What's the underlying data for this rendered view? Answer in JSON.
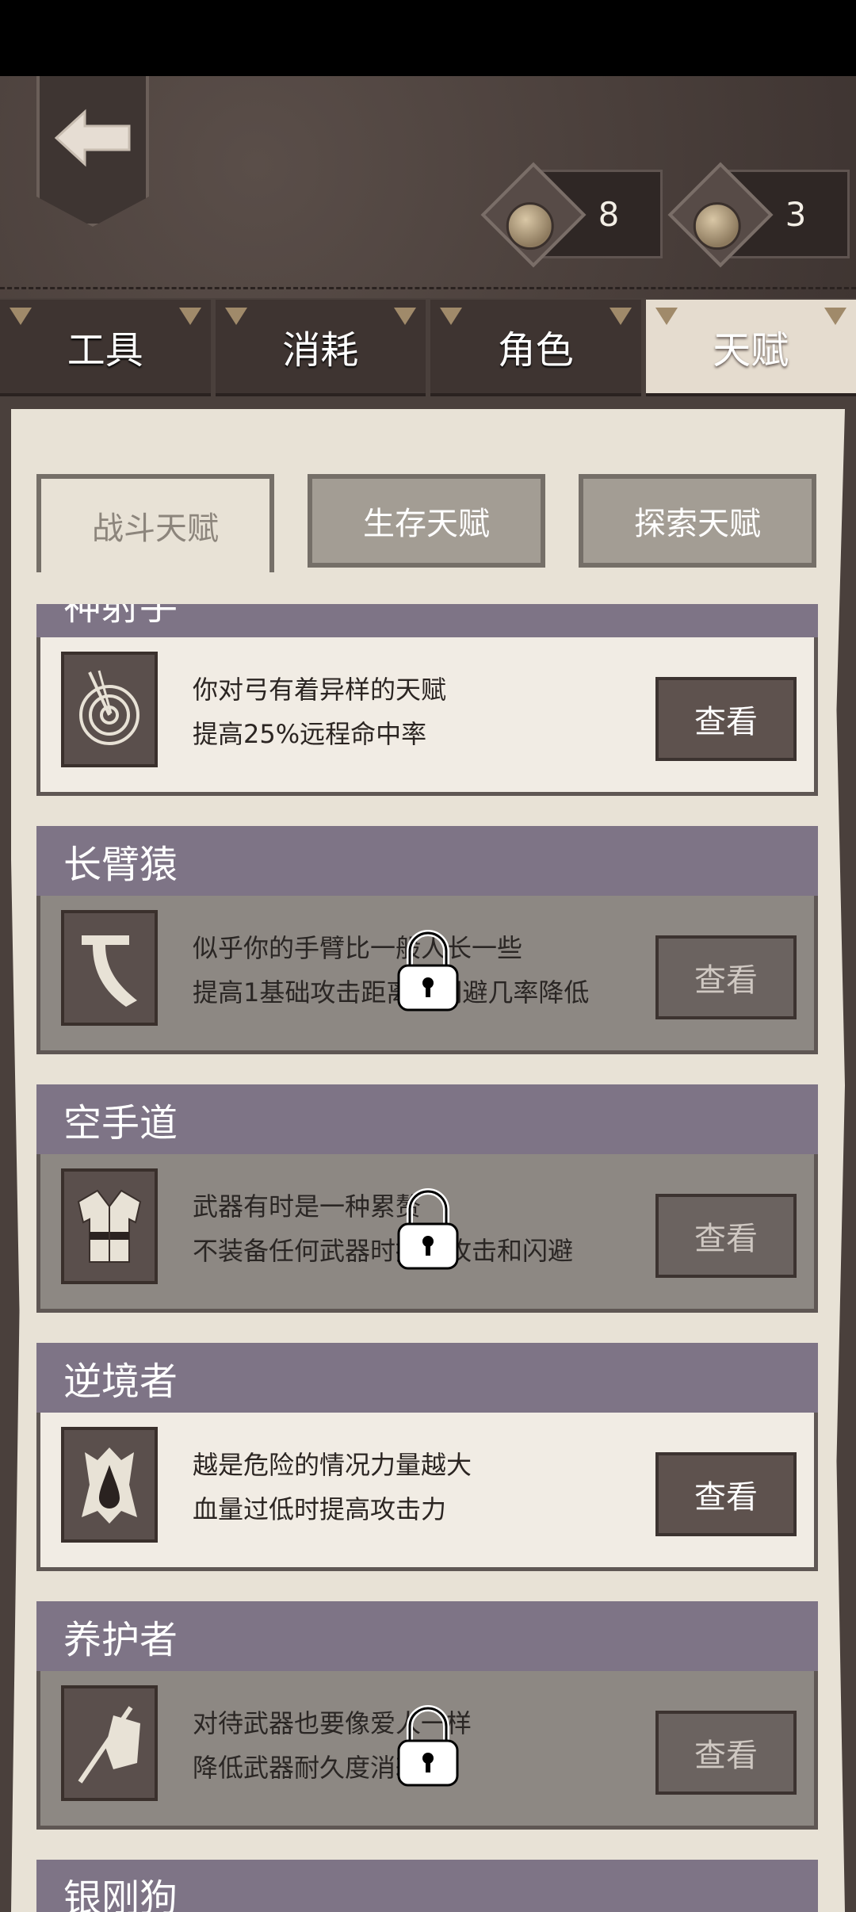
{
  "header": {
    "back_icon": "back-arrow-icon",
    "currencies": [
      {
        "icon": "sword-coin-icon",
        "value": "8"
      },
      {
        "icon": "sword-coin-icon",
        "value": "3"
      }
    ]
  },
  "tabs": [
    {
      "label": "工具"
    },
    {
      "label": "消耗"
    },
    {
      "label": "角色"
    },
    {
      "label": "天赋"
    }
  ],
  "subtabs": [
    {
      "label": "战斗天赋"
    },
    {
      "label": "生存天赋"
    },
    {
      "label": "探索天赋"
    }
  ],
  "talents": [
    {
      "title": "神射手",
      "icon": "target-arrow-icon",
      "line1": "你对弓有着异样的天赋",
      "line2": "提高25%远程命中率",
      "button": "查看",
      "locked": false
    },
    {
      "title": "长臂猿",
      "icon": "long-arm-icon",
      "line1": "似乎你的手臂比一般人长一些",
      "line2": "提高1基础攻击距离，闪避几率降低",
      "button": "查看",
      "locked": true
    },
    {
      "title": "空手道",
      "icon": "karate-gi-icon",
      "line1": "武器有时是一种累赘",
      "line2": "不装备任何武器时提高攻击和闪避",
      "button": "查看",
      "locked": true
    },
    {
      "title": "逆境者",
      "icon": "blood-drop-icon",
      "line1": "越是危险的情况力量越大",
      "line2": "血量过低时提高攻击力",
      "button": "查看",
      "locked": false
    },
    {
      "title": "养护者",
      "icon": "weapon-cloth-icon",
      "line1": "对待武器也要像爱人一样",
      "line2": "降低武器耐久度消耗",
      "button": "查看",
      "locked": true
    }
  ],
  "next_talent_title": "银刚狗"
}
